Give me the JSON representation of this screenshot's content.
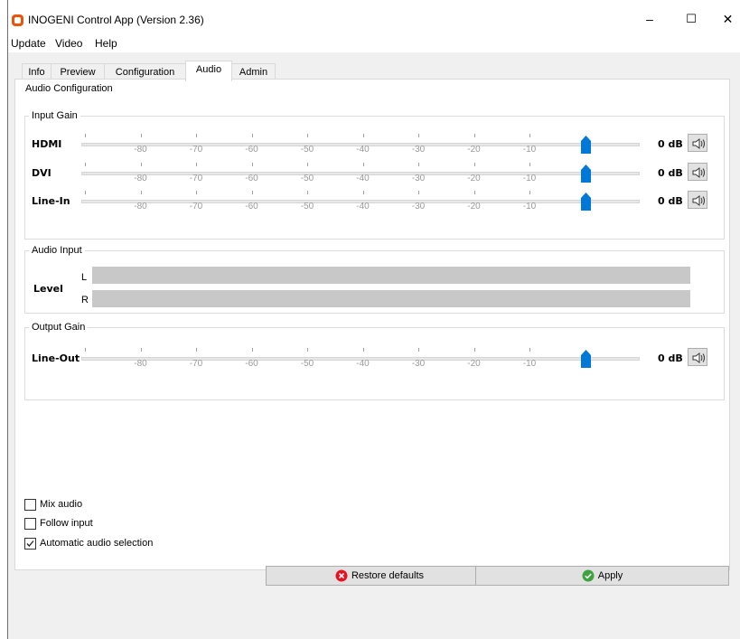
{
  "window": {
    "title": "INOGENI Control App (Version 2.36)",
    "controls": {
      "minimize": "–",
      "maximize": "☐",
      "close": "✕"
    }
  },
  "menu": [
    "Update",
    "Video",
    "Help"
  ],
  "tabs": [
    {
      "label": "Info",
      "active": false
    },
    {
      "label": "Preview",
      "active": false
    },
    {
      "label": "Configuration",
      "active": false
    },
    {
      "label": "Audio",
      "active": true
    },
    {
      "label": "Admin",
      "active": false
    }
  ],
  "audio_config": {
    "title": "Audio Configuration",
    "input_gain": {
      "title": "Input Gain",
      "scale_labels": [
        "-80",
        "-70",
        "-60",
        "-50",
        "-40",
        "-30",
        "-20",
        "-10"
      ],
      "channels": [
        {
          "label": "HDMI",
          "value": "0 dB",
          "mute_icon": "speaker-icon"
        },
        {
          "label": "DVI",
          "value": "0 dB",
          "mute_icon": "speaker-icon"
        },
        {
          "label": "Line-In",
          "value": "0 dB",
          "mute_icon": "speaker-icon"
        }
      ]
    },
    "audio_input": {
      "title": "Audio Input",
      "level_label": "Level",
      "left_label": "L",
      "right_label": "R",
      "left_level": 0,
      "right_level": 0
    },
    "output_gain": {
      "title": "Output Gain",
      "scale_labels": [
        "-80",
        "-70",
        "-60",
        "-50",
        "-40",
        "-30",
        "-20",
        "-10"
      ],
      "channels": [
        {
          "label": "Line-Out",
          "value": "0 dB",
          "mute_icon": "speaker-icon"
        }
      ]
    }
  },
  "options": [
    {
      "label": "Mix audio",
      "checked": false
    },
    {
      "label": "Follow input",
      "checked": false
    },
    {
      "label": "Automatic audio selection",
      "checked": true
    }
  ],
  "buttons": {
    "restore": {
      "label": "Restore defaults",
      "icon": "error-x-icon",
      "color": "#e81123"
    },
    "apply": {
      "label": "Apply",
      "icon": "check-icon",
      "color": "#3ea33e"
    }
  },
  "colors": {
    "accent": "#0078d7",
    "app_icon": "#e8550c"
  }
}
